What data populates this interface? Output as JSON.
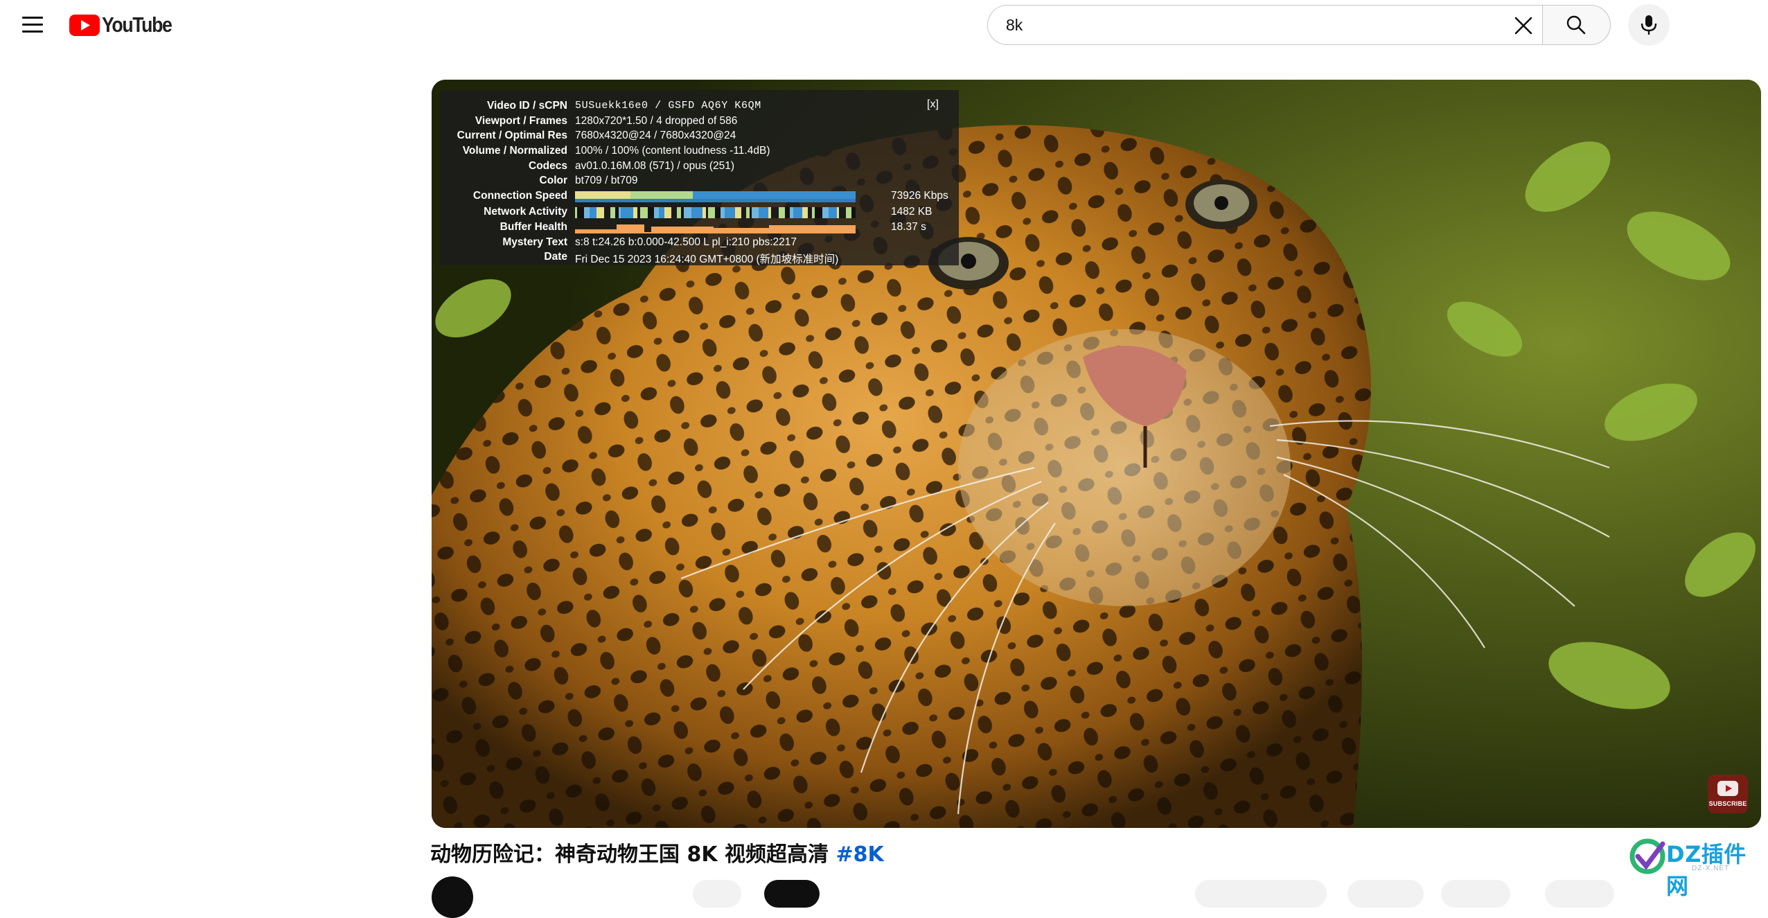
{
  "header": {
    "logo_text": "YouTube",
    "search": {
      "value": "8k",
      "placeholder": ""
    },
    "icons": [
      "menu-icon",
      "youtube-logo-icon",
      "clear-icon",
      "search-icon",
      "mic-icon"
    ]
  },
  "player": {
    "stats": {
      "close_label": "[x]",
      "rows": [
        {
          "label": "Video ID / sCPN",
          "value": "5USuekk16e0 / GSFD AQ6Y K6QM"
        },
        {
          "label": "Viewport / Frames",
          "value": "1280x720*1.50 / 4 dropped of 586"
        },
        {
          "label": "Current / Optimal Res",
          "value": "7680x4320@24 / 7680x4320@24"
        },
        {
          "label": "Volume / Normalized",
          "value": "100% / 100% (content loudness -11.4dB)"
        },
        {
          "label": "Codecs",
          "value": "av01.0.16M.08 (571) / opus (251)"
        },
        {
          "label": "Color",
          "value": "bt709 / bt709"
        },
        {
          "label": "Connection Speed",
          "reading": "73926 Kbps"
        },
        {
          "label": "Network Activity",
          "reading": "1482 KB"
        },
        {
          "label": "Buffer Health",
          "reading": "18.37 s"
        },
        {
          "label": "Mystery Text",
          "value": "s:8 t:24.26 b:0.000-42.500 L pl_i:210 pbs:2217"
        },
        {
          "label": "Date",
          "value": "Fri Dec 15 2023 16:24:40 GMT+0800 (新加坡标准时间)"
        }
      ]
    },
    "subscribe_badge": "SUBSCRIBE",
    "colors": {
      "graph_green": "#b3d98a",
      "graph_blue": "#3a8fcf",
      "graph_orange": "#f3a35a"
    }
  },
  "video": {
    "title": "动物历险记：神奇动物王国 8K 视频超高清",
    "hashtag": "#8K"
  },
  "watermark": {
    "text": "DZ插件网",
    "sub": "DZ-X.NET"
  }
}
